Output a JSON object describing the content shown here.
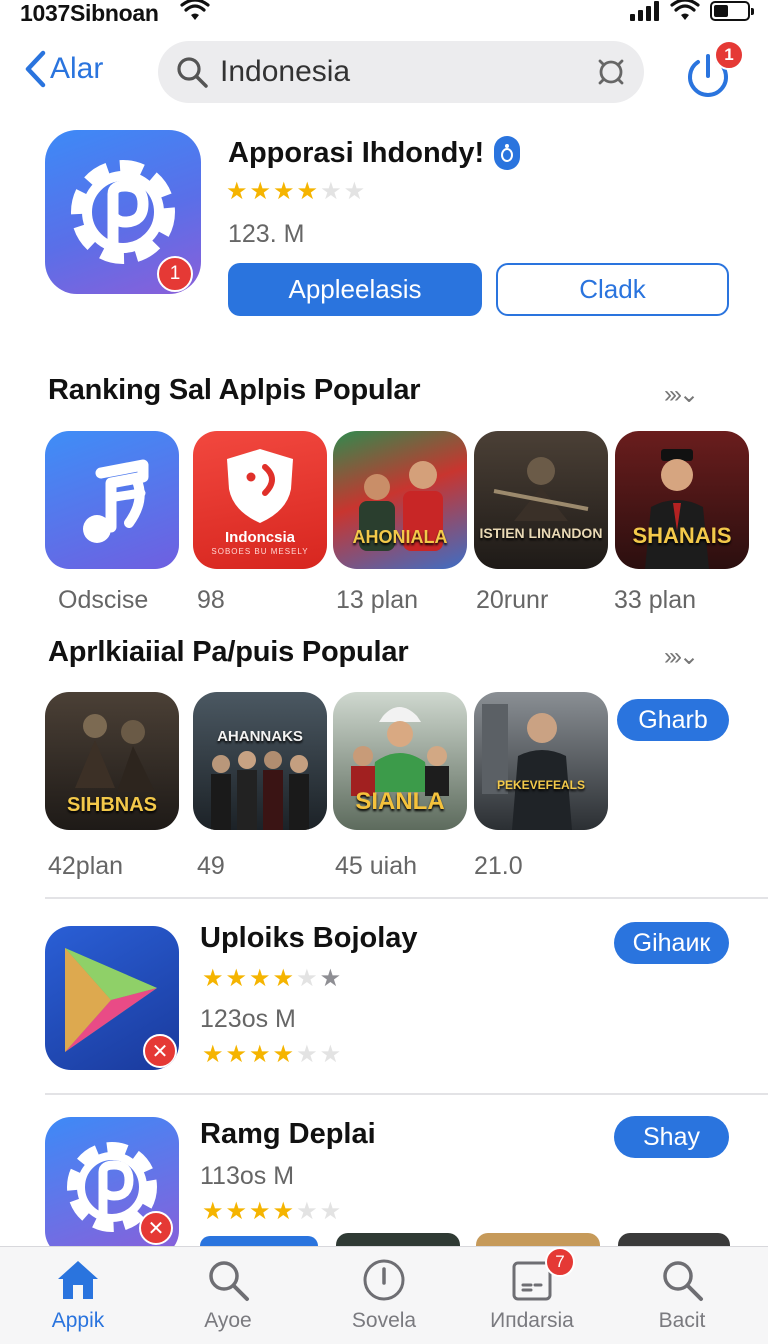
{
  "status": {
    "time": "1037Sibnoan"
  },
  "nav": {
    "back_label": "Alar",
    "search_value": "Indonesia",
    "notification_count": "1"
  },
  "featured": {
    "title": "Apporasi Ihdondy!",
    "rating": 3.5,
    "size": "123. M",
    "icon_badge": "1",
    "primary_button": "Appleelasis",
    "secondary_button": "Cladk"
  },
  "section1": {
    "title": "Ranking Sal Aplpis Popular",
    "more": "›››⌄",
    "items": [
      {
        "caption": "Odscise",
        "icon": "music-note-icon"
      },
      {
        "caption": "98",
        "icon": "shield-smile-icon",
        "label": "Indoncsia",
        "sublabel": "SOBOES BU MESELY"
      },
      {
        "caption": "13 plan",
        "icon": "movie-poster",
        "label": "AHONIALA"
      },
      {
        "caption": "20runr",
        "icon": "movie-poster",
        "label": "ISTIEN LINANDON"
      },
      {
        "caption": "33 plan",
        "icon": "movie-poster",
        "label": "SHANAIS"
      }
    ]
  },
  "section2": {
    "title": "Aprlkiaiial Pa/puis Popular",
    "more": "›››⌄",
    "pill": "Gharb",
    "items": [
      {
        "caption": "42plan",
        "label": "SIHBNAS"
      },
      {
        "caption": "49",
        "label": "AHANNAKS"
      },
      {
        "caption": "45 uiah",
        "label": "SIANLA"
      },
      {
        "caption": "21.0",
        "label": "PEKEVEFEALS"
      }
    ]
  },
  "list": [
    {
      "title": "Uploiks Bojolay",
      "size": "123os M",
      "button": "Gihaик",
      "rating": 3.5,
      "rating2": 3.5
    },
    {
      "title": "Ramg Deplai",
      "size": "113os M",
      "button": "Shay",
      "rating": 3.5
    }
  ],
  "tabs": [
    {
      "label": "Appik",
      "icon": "home-icon"
    },
    {
      "label": "Ayoe",
      "icon": "search-icon"
    },
    {
      "label": "Sovela",
      "icon": "clock-icon"
    },
    {
      "label": "Ипdarsia",
      "icon": "document-icon",
      "badge": "7"
    },
    {
      "label": "Bacit",
      "icon": "search-icon"
    }
  ],
  "colors": {
    "accent": "#2a74de",
    "badge": "#e53935",
    "star": "#f5b400"
  }
}
